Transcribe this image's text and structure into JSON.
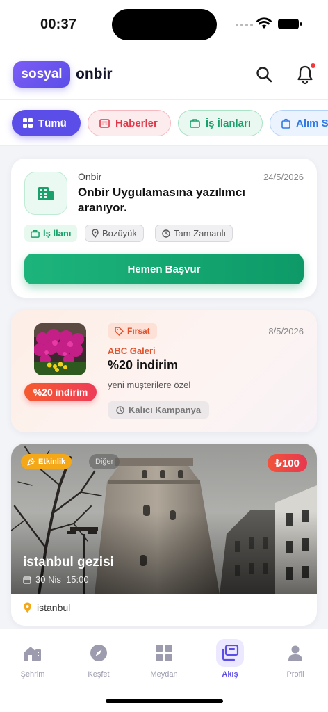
{
  "status_bar": {
    "time": "00:37"
  },
  "header": {
    "logo_badge": "sosyal",
    "logo_text": "onbir",
    "icons": [
      "search-icon",
      "bell-icon"
    ],
    "has_notification": true
  },
  "filters": [
    {
      "label": "Tümü",
      "icon": "grid-icon",
      "active": true
    },
    {
      "label": "Haberler",
      "icon": "newspaper-icon"
    },
    {
      "label": "İş İlanları",
      "icon": "briefcase-icon"
    },
    {
      "label": "Alım S",
      "icon": "shopping-bag-icon"
    }
  ],
  "job_post": {
    "source": "Onbir",
    "date": "24/5/2026",
    "title": "Onbir Uygulamasına yazılımcı aranıyor.",
    "tags": {
      "type": "İş İlanı",
      "location": "Bozüyük",
      "schedule": "Tam Zamanlı"
    },
    "apply_label": "Hemen Başvur",
    "accent": "#1aa06a"
  },
  "deal_post": {
    "tag": "Fırsat",
    "date": "8/5/2026",
    "company": "ABC Galeri",
    "title": "%20 indirim",
    "subtitle": "yeni müşterilere özel",
    "badge": "%20 indirim",
    "duration": "Kalıcı Kampanya",
    "accent": "#e2512b"
  },
  "event_post": {
    "tag": "Etkinlik",
    "category": "Diğer",
    "price": "₺100",
    "title": "istanbul gezisi",
    "datetime": "30 Nis  15:00",
    "location": "istanbul"
  },
  "tabbar": {
    "items": [
      {
        "label": "Şehrim",
        "icon": "city-icon"
      },
      {
        "label": "Keşfet",
        "icon": "compass-icon"
      },
      {
        "label": "Meydan",
        "icon": "grid-icon"
      },
      {
        "label": "Akış",
        "icon": "feed-icon",
        "active": true
      },
      {
        "label": "Profil",
        "icon": "profile-icon"
      }
    ],
    "active_color": "#5b4ee8"
  }
}
